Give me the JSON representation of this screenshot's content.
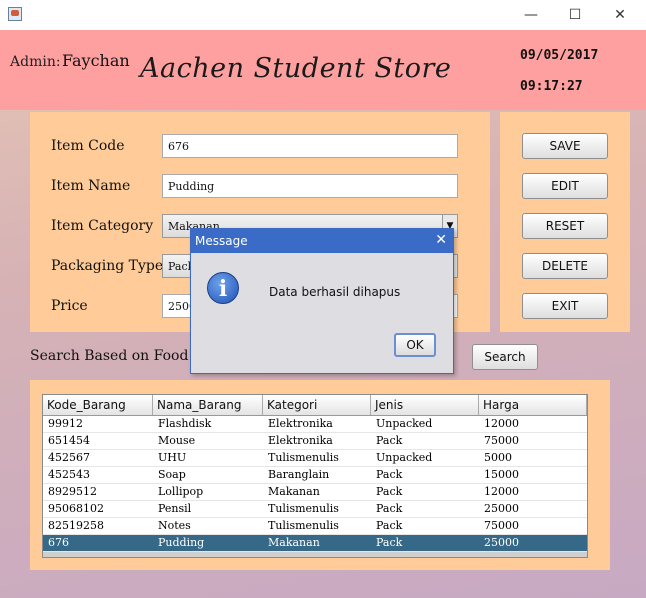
{
  "window": {
    "minimize": "—",
    "maximize": "☐",
    "close": "✕"
  },
  "header": {
    "admin_label": "Admin:",
    "admin_name": "Faychan",
    "title": "Aachen Student Store",
    "date": "09/05/2017",
    "time": "09:17:27"
  },
  "form": {
    "item_code_label": "Item Code",
    "item_code_value": "676",
    "item_name_label": "Item Name",
    "item_name_value": "Pudding",
    "item_category_label": "Item Category",
    "item_category_value": "Makanan",
    "packaging_type_label": "Packaging Type",
    "packaging_type_value": "Pack",
    "price_label": "Price",
    "price_value": "25000"
  },
  "buttons": {
    "save": "SAVE",
    "edit": "EDIT",
    "reset": "RESET",
    "delete": "DELETE",
    "exit": "EXIT"
  },
  "search": {
    "label": "Search Based on Food C",
    "button": "Search"
  },
  "table": {
    "columns": [
      "Kode_Barang",
      "Nama_Barang",
      "Kategori",
      "Jenis",
      "Harga"
    ],
    "rows": [
      [
        "99912",
        "Flashdisk",
        "Elektronika",
        "Unpacked",
        "12000"
      ],
      [
        "651454",
        "Mouse",
        "Elektronika",
        "Pack",
        "75000"
      ],
      [
        "452567",
        "UHU",
        "Tulismenulis",
        "Unpacked",
        "5000"
      ],
      [
        "452543",
        "Soap",
        "Baranglain",
        "Pack",
        "15000"
      ],
      [
        "8929512",
        "Lollipop",
        "Makanan",
        "Pack",
        "12000"
      ],
      [
        "95068102",
        "Pensil",
        "Tulismenulis",
        "Pack",
        "25000"
      ],
      [
        "82519258",
        "Notes",
        "Tulismenulis",
        "Pack",
        "75000"
      ],
      [
        "676",
        "Pudding",
        "Makanan",
        "Pack",
        "25000"
      ]
    ],
    "selected_row": 7
  },
  "dialog": {
    "title": "Message",
    "close": "✕",
    "icon": "i",
    "message": "Data berhasil dihapus",
    "ok": "OK"
  },
  "colors": {
    "header": "#fea0a0",
    "panel": "#ffcc99",
    "selected_row": "#366987",
    "dialog_title": "#3a6cc7"
  }
}
